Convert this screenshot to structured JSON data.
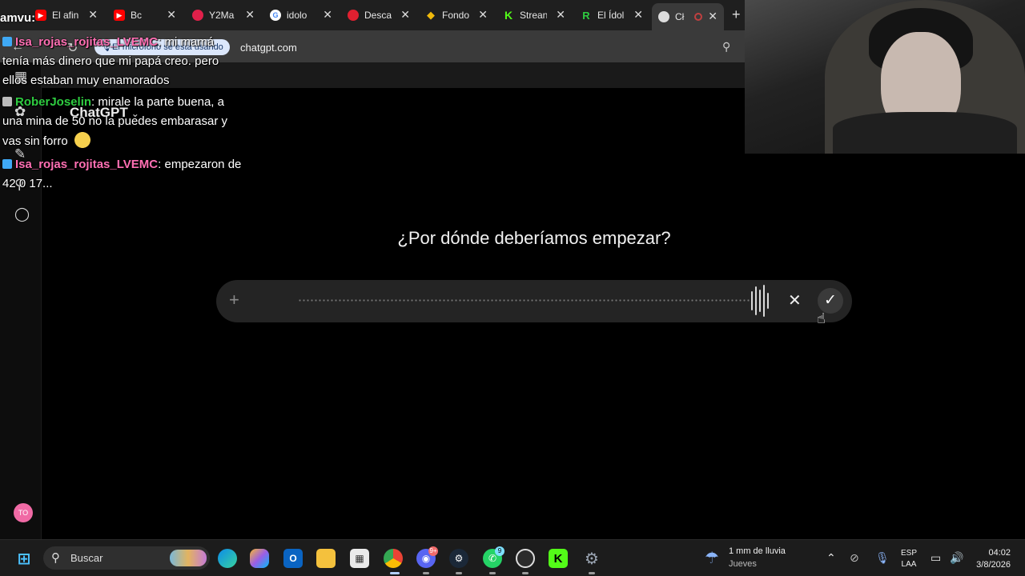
{
  "browser": {
    "tabs": [
      {
        "title": "El afin",
        "favicon_color": "#ff0000"
      },
      {
        "title": "Bc",
        "favicon_color": "#ff0000"
      },
      {
        "title": "Y2Ma",
        "favicon_color": "#e0204a"
      },
      {
        "title": "idolo",
        "favicon_color": "#ffffff"
      },
      {
        "title": "Desca",
        "favicon_color": "#e02030"
      },
      {
        "title": "Fondo",
        "favicon_color": "#f0b90b"
      },
      {
        "title": "Strean",
        "favicon_color": "#53fc18"
      },
      {
        "title": "El Ídol",
        "favicon_color": "#2ecc40"
      },
      {
        "title": "Cł",
        "favicon_color": "#cccccc"
      }
    ],
    "new_tab": "+",
    "close_glyph": "✕",
    "mic_notice": "El micrófono se está usando",
    "url": "chatgpt.com"
  },
  "app": {
    "title": "ChatGPT",
    "prompt": "¿Por dónde deberíamos empezar?",
    "avatar_initials": "TO",
    "accent": "#f06aa5"
  },
  "chat": {
    "channel": "amvu:",
    "messages": [
      {
        "user": "Isa_rojas_rojitas_LVEMC",
        "text": "mi mamá tenía más dinero que mi papá creo. pero ellos estaban muy enamorados",
        "user_color": "#ff6fb3"
      },
      {
        "user": "RoberJoselin",
        "text": "mirale la parte buena, a una mina de 50 no la puedes embarasar y vas sin forro",
        "user_color": "#2ecc40"
      },
      {
        "user": "Isa_rojas_rojitas_LVEMC",
        "text": "empezaron de 42 0 17...",
        "user_color": "#ff6fb3"
      }
    ]
  },
  "taskbar": {
    "search_label": "Buscar",
    "weather_title": "1 mm de lluvia",
    "weather_day": "Jueves",
    "lang_top": "ESP",
    "lang_bottom": "LAA",
    "time": "04:02",
    "date": "3/8/2026",
    "discord_badge": "9+",
    "whatsapp_badge": "9"
  }
}
